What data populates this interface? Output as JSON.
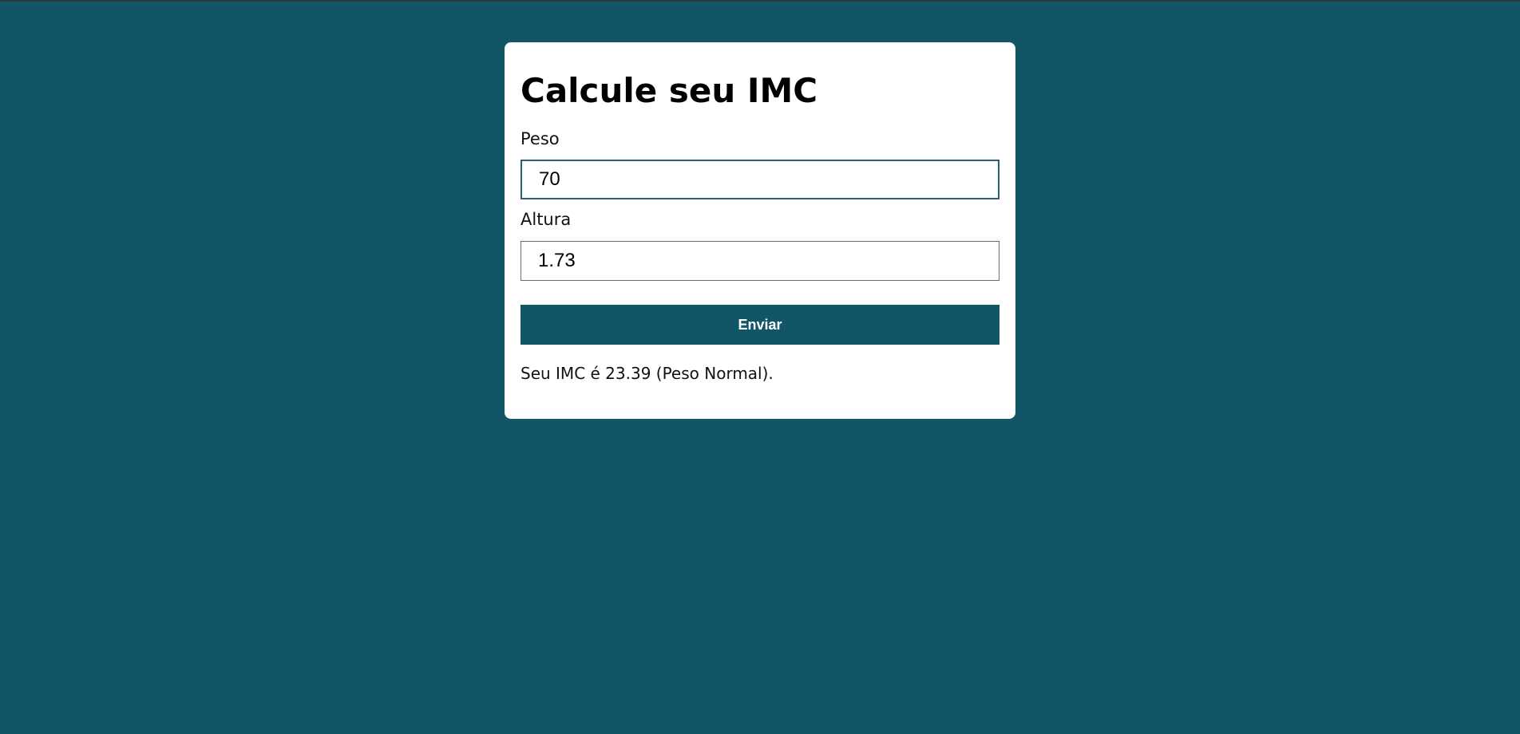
{
  "page": {
    "background_color": "#115566",
    "accent_color": "#115566"
  },
  "form": {
    "title": "Calcule seu IMC",
    "peso_label": "Peso",
    "peso_value": "70",
    "altura_label": "Altura",
    "altura_value": "1.73",
    "submit_label": "Enviar"
  },
  "result": {
    "text": "Seu IMC é 23.39 (Peso Normal)."
  }
}
